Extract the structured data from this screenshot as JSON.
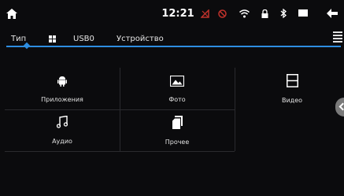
{
  "status": {
    "time": "12:21"
  },
  "tabs": [
    {
      "label": "Тип"
    },
    {
      "label": "USB0"
    },
    {
      "label": "Устройство"
    }
  ],
  "categories": [
    {
      "label": "Приложения",
      "icon": "android-icon"
    },
    {
      "label": "Фото",
      "icon": "photo-icon"
    },
    {
      "label": "Видео",
      "icon": "film-icon"
    },
    {
      "label": "Аудио",
      "icon": "music-note-icon"
    },
    {
      "label": "Прочее",
      "icon": "files-icon"
    }
  ],
  "colors": {
    "accent": "#2e8de0",
    "background": "#0b0b0d",
    "warning_icon": "#c0322b"
  }
}
